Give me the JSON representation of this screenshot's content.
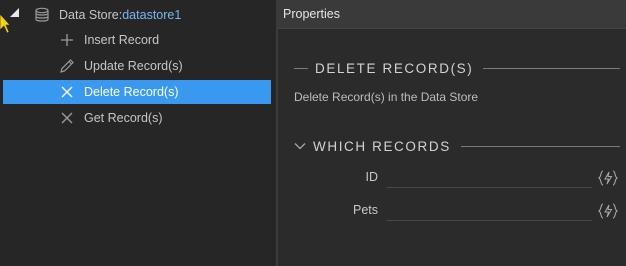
{
  "tree": {
    "root_label": "Data Store: ",
    "root_value": "datastore1",
    "items": [
      {
        "label": "Insert Record",
        "icon": "plus-icon"
      },
      {
        "label": "Update Record(s)",
        "icon": "pencil-icon"
      },
      {
        "label": "Delete Record(s)",
        "icon": "close-icon",
        "selected": true
      },
      {
        "label": "Get Record(s)",
        "icon": "close-icon"
      }
    ]
  },
  "properties": {
    "header": "Properties",
    "section_delete": {
      "title": "DELETE RECORD(S)",
      "description": "Delete Record(s) in the Data Store"
    },
    "section_which": {
      "title": "WHICH RECORDS",
      "fields": [
        {
          "label": "ID",
          "value": ""
        },
        {
          "label": "Pets",
          "value": ""
        }
      ]
    }
  },
  "colors": {
    "selection": "#3999f0",
    "datastore_name": "#78b6ee",
    "panel_bg": "#2b2b2b"
  }
}
